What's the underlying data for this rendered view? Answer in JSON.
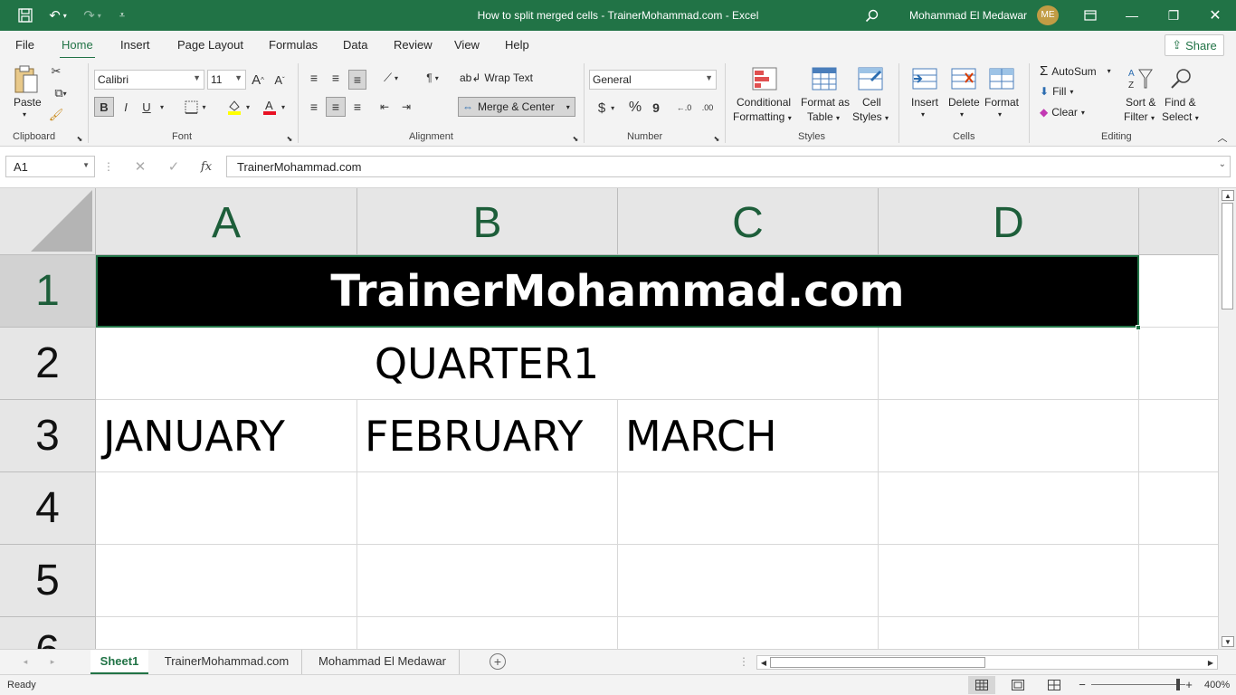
{
  "window": {
    "title": "How to split merged cells - TrainerMohammad.com  -  Excel",
    "user_name": "Mohammad El Medawar",
    "user_initials": "ME"
  },
  "menu": {
    "tabs": [
      "File",
      "Home",
      "Insert",
      "Page Layout",
      "Formulas",
      "Data",
      "Review",
      "View",
      "Help"
    ],
    "active": "Home",
    "share_label": "Share"
  },
  "ribbon": {
    "clipboard": {
      "group_label": "Clipboard",
      "paste_label": "Paste"
    },
    "font": {
      "group_label": "Font",
      "font_name": "Calibri",
      "font_size": "11",
      "bold": "B",
      "italic": "I",
      "underline": "U",
      "font_color": "#e81123",
      "highlight_color": "#ffff00"
    },
    "alignment": {
      "group_label": "Alignment",
      "wrap_text": "Wrap Text",
      "merge_center": "Merge & Center"
    },
    "number": {
      "group_label": "Number",
      "format": "General",
      "currency": "$",
      "percent": "%",
      "comma": "9"
    },
    "styles": {
      "group_label": "Styles",
      "conditional_1": "Conditional",
      "conditional_2": "Formatting",
      "format_table_1": "Format as",
      "format_table_2": "Table",
      "cell_styles_1": "Cell",
      "cell_styles_2": "Styles"
    },
    "cells": {
      "group_label": "Cells",
      "insert": "Insert",
      "delete": "Delete",
      "format": "Format"
    },
    "editing": {
      "group_label": "Editing",
      "autosum": "AutoSum",
      "fill": "Fill",
      "clear": "Clear",
      "sort_1": "Sort &",
      "sort_2": "Filter",
      "find_1": "Find &",
      "find_2": "Select"
    }
  },
  "formula_bar": {
    "name_box": "A1",
    "formula": "TrainerMohammad.com",
    "fx": "fx"
  },
  "grid": {
    "columns": [
      "A",
      "B",
      "C",
      "D"
    ],
    "rows": [
      "1",
      "2",
      "3",
      "4",
      "5",
      "6"
    ],
    "cells": {
      "merged_row1": "TrainerMohammad.com",
      "row2_quarter": "QUARTER1",
      "a3": "JANUARY",
      "b3": "FEBRUARY",
      "c3": "MARCH"
    },
    "accent_color": "#217346"
  },
  "sheets": {
    "tabs": [
      "Sheet1",
      "TrainerMohammad.com",
      "Mohammad El Medawar"
    ],
    "active": "Sheet1"
  },
  "status": {
    "mode": "Ready",
    "zoom": "400%"
  }
}
